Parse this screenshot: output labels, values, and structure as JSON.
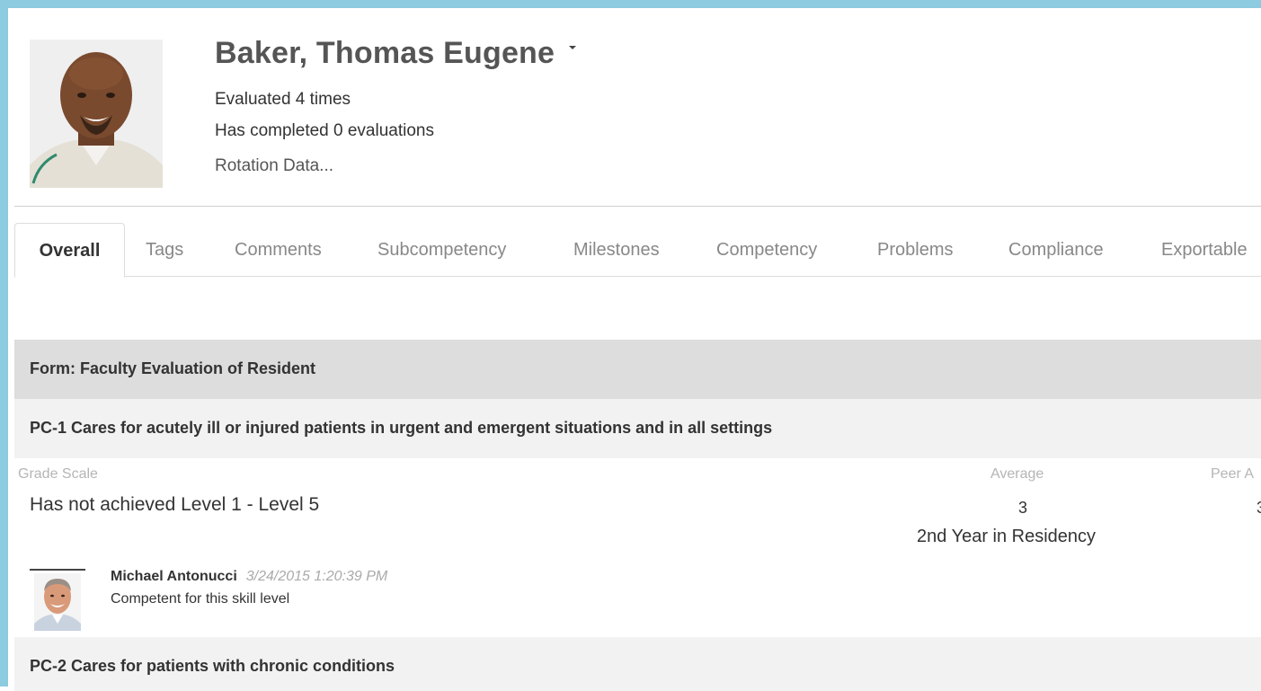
{
  "profile": {
    "name": "Baker, Thomas Eugene",
    "evaluated": "Evaluated 4 times",
    "completed": "Has completed 0 evaluations",
    "rotation_link": "Rotation Data..."
  },
  "tabs": [
    {
      "label": "Overall",
      "active": true
    },
    {
      "label": "Tags"
    },
    {
      "label": "Comments"
    },
    {
      "label": "Subcompetency"
    },
    {
      "label": "Milestones"
    },
    {
      "label": "Competency"
    },
    {
      "label": "Problems"
    },
    {
      "label": "Compliance"
    },
    {
      "label": "Exportable"
    }
  ],
  "form": {
    "title": "Form: Faculty Evaluation of Resident",
    "items": [
      {
        "title": "PC-1 Cares for acutely ill or injured patients in urgent and emergent situations and in all settings",
        "grade_scale_label": "Grade Scale",
        "grade_scale_value": "Has not achieved Level 1 - Level 5",
        "average_label": "Average",
        "average_value": "3",
        "peer_label": "Peer A",
        "peer_value": "3",
        "year": "2nd Year in Residency",
        "comment": {
          "author": "Michael Antonucci",
          "timestamp": "3/24/2015 1:20:39 PM",
          "text": "Competent for this skill level"
        }
      },
      {
        "title": "PC-2 Cares for patients with chronic conditions"
      }
    ]
  },
  "colors": {
    "frame": "#8ccbe0",
    "form_header_bg": "#dddddd",
    "item_header_bg": "#f2f2f2"
  }
}
